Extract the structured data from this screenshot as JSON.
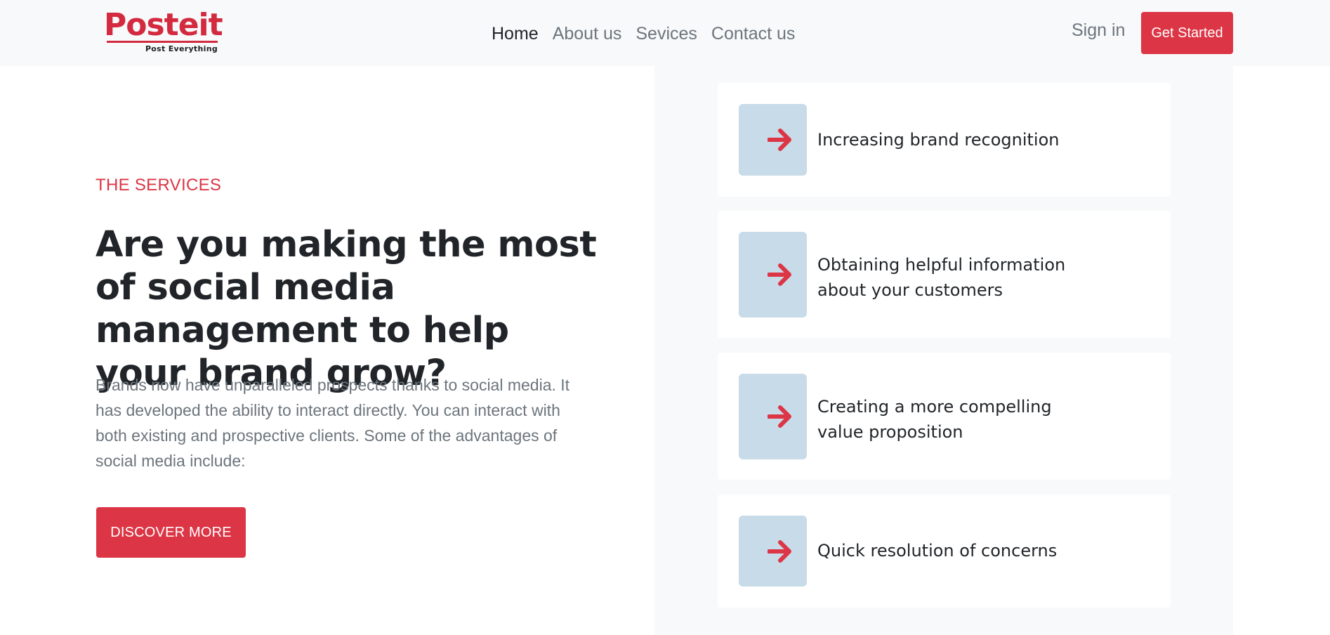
{
  "brand": {
    "logo_word": "Posteit",
    "tagline": "Post Everything",
    "accent_color": "#dc3545"
  },
  "nav": {
    "links": [
      "Home",
      "About us",
      "Sevices",
      "Contact us"
    ],
    "active": "Home",
    "sign_in_label": "Sign in",
    "get_started_label": "Get Started"
  },
  "hero": {
    "eyebrow": "THE SERVICES",
    "headline": "Are you making the most of social media management to help your brand grow?",
    "lead": "Brands now have unparalleled prospects thanks to social media. It has developed the ability to interact directly. You can interact with both existing and prospective clients. Some of the advantages of social media include:",
    "cta_label": "DISCOVER MORE"
  },
  "benefits": {
    "icon": "arrow-right-icon",
    "items": [
      {
        "label": "Increasing brand recognition"
      },
      {
        "label": "Obtaining helpful information about your customers"
      },
      {
        "label": "Creating a more compelling value proposition"
      },
      {
        "label": "Quick resolution of concerns"
      }
    ]
  }
}
